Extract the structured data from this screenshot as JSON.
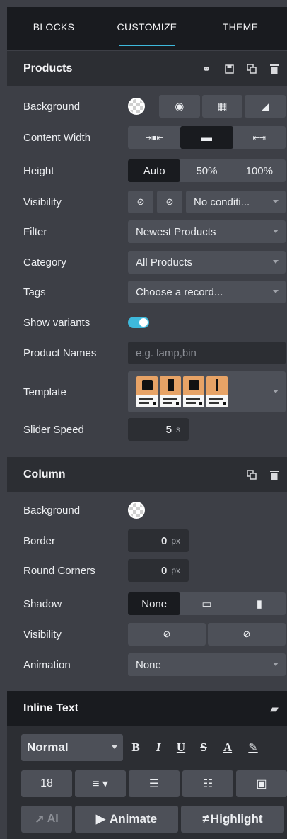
{
  "tabs": [
    "BLOCKS",
    "CUSTOMIZE",
    "THEME"
  ],
  "products": {
    "title": "Products",
    "background_label": "Background",
    "content_width_label": "Content Width",
    "height_label": "Height",
    "height_options": [
      "Auto",
      "50%",
      "100%"
    ],
    "visibility_label": "Visibility",
    "visibility_value": "No conditi...",
    "filter_label": "Filter",
    "filter_value": "Newest Products",
    "category_label": "Category",
    "category_value": "All Products",
    "tags_label": "Tags",
    "tags_placeholder": "Choose a record...",
    "show_variants_label": "Show variants",
    "show_variants_on": true,
    "product_names_label": "Product Names",
    "product_names_placeholder": "e.g. lamp,bin",
    "template_label": "Template",
    "slider_speed_label": "Slider Speed",
    "slider_speed_value": "5",
    "slider_speed_unit": "s"
  },
  "column": {
    "title": "Column",
    "background_label": "Background",
    "border_label": "Border",
    "border_value": "0",
    "border_unit": "px",
    "round_corners_label": "Round Corners",
    "round_corners_value": "0",
    "round_corners_unit": "px",
    "shadow_label": "Shadow",
    "shadow_value": "None",
    "visibility_label": "Visibility",
    "animation_label": "Animation",
    "animation_value": "None"
  },
  "inline_text": {
    "title": "Inline Text",
    "style_value": "Normal",
    "bold": "B",
    "italic": "I",
    "underline": "U",
    "strike": "S",
    "font_color": "A",
    "font_size": "18",
    "ai_label": "AI",
    "animate_label": "Animate",
    "highlight_label": "Highlight"
  },
  "colors": {
    "accent": "#3eb9dc",
    "panel": "#3d3f46",
    "header": "#2c2e33",
    "dark": "#191b1f",
    "button": "#4d5058"
  }
}
